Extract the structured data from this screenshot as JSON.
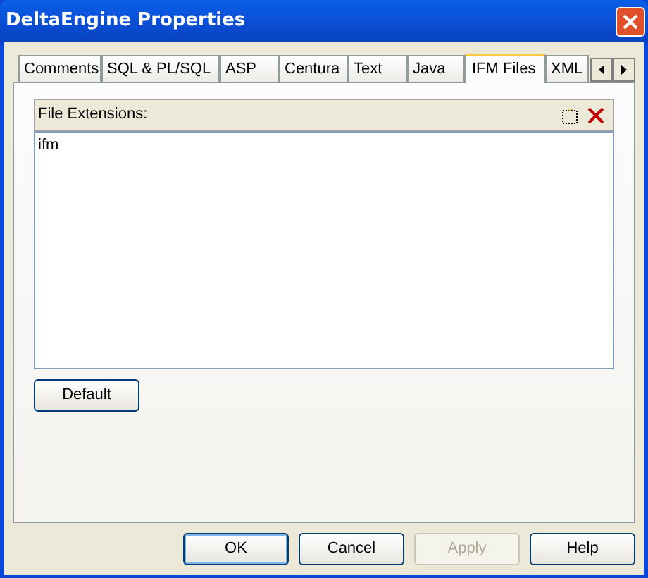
{
  "window": {
    "title": "DeltaEngine Properties"
  },
  "tabs": [
    {
      "label": "Comments",
      "selected": false
    },
    {
      "label": "SQL & PL/SQL",
      "selected": false
    },
    {
      "label": "ASP",
      "selected": false
    },
    {
      "label": "Centura",
      "selected": false
    },
    {
      "label": "Text",
      "selected": false
    },
    {
      "label": "Java",
      "selected": false
    },
    {
      "label": "IFM Files",
      "selected": true
    },
    {
      "label": "XML",
      "selected": false
    }
  ],
  "panel": {
    "list_label": "File Extensions:",
    "items": [
      {
        "label": "ifm",
        "selected": false
      }
    ],
    "default_button": "Default"
  },
  "buttons": [
    {
      "label": "OK",
      "disabled": false,
      "default": true
    },
    {
      "label": "Cancel",
      "disabled": false,
      "default": false
    },
    {
      "label": "Apply",
      "disabled": true,
      "default": false
    },
    {
      "label": "Help",
      "disabled": false,
      "default": false
    }
  ]
}
